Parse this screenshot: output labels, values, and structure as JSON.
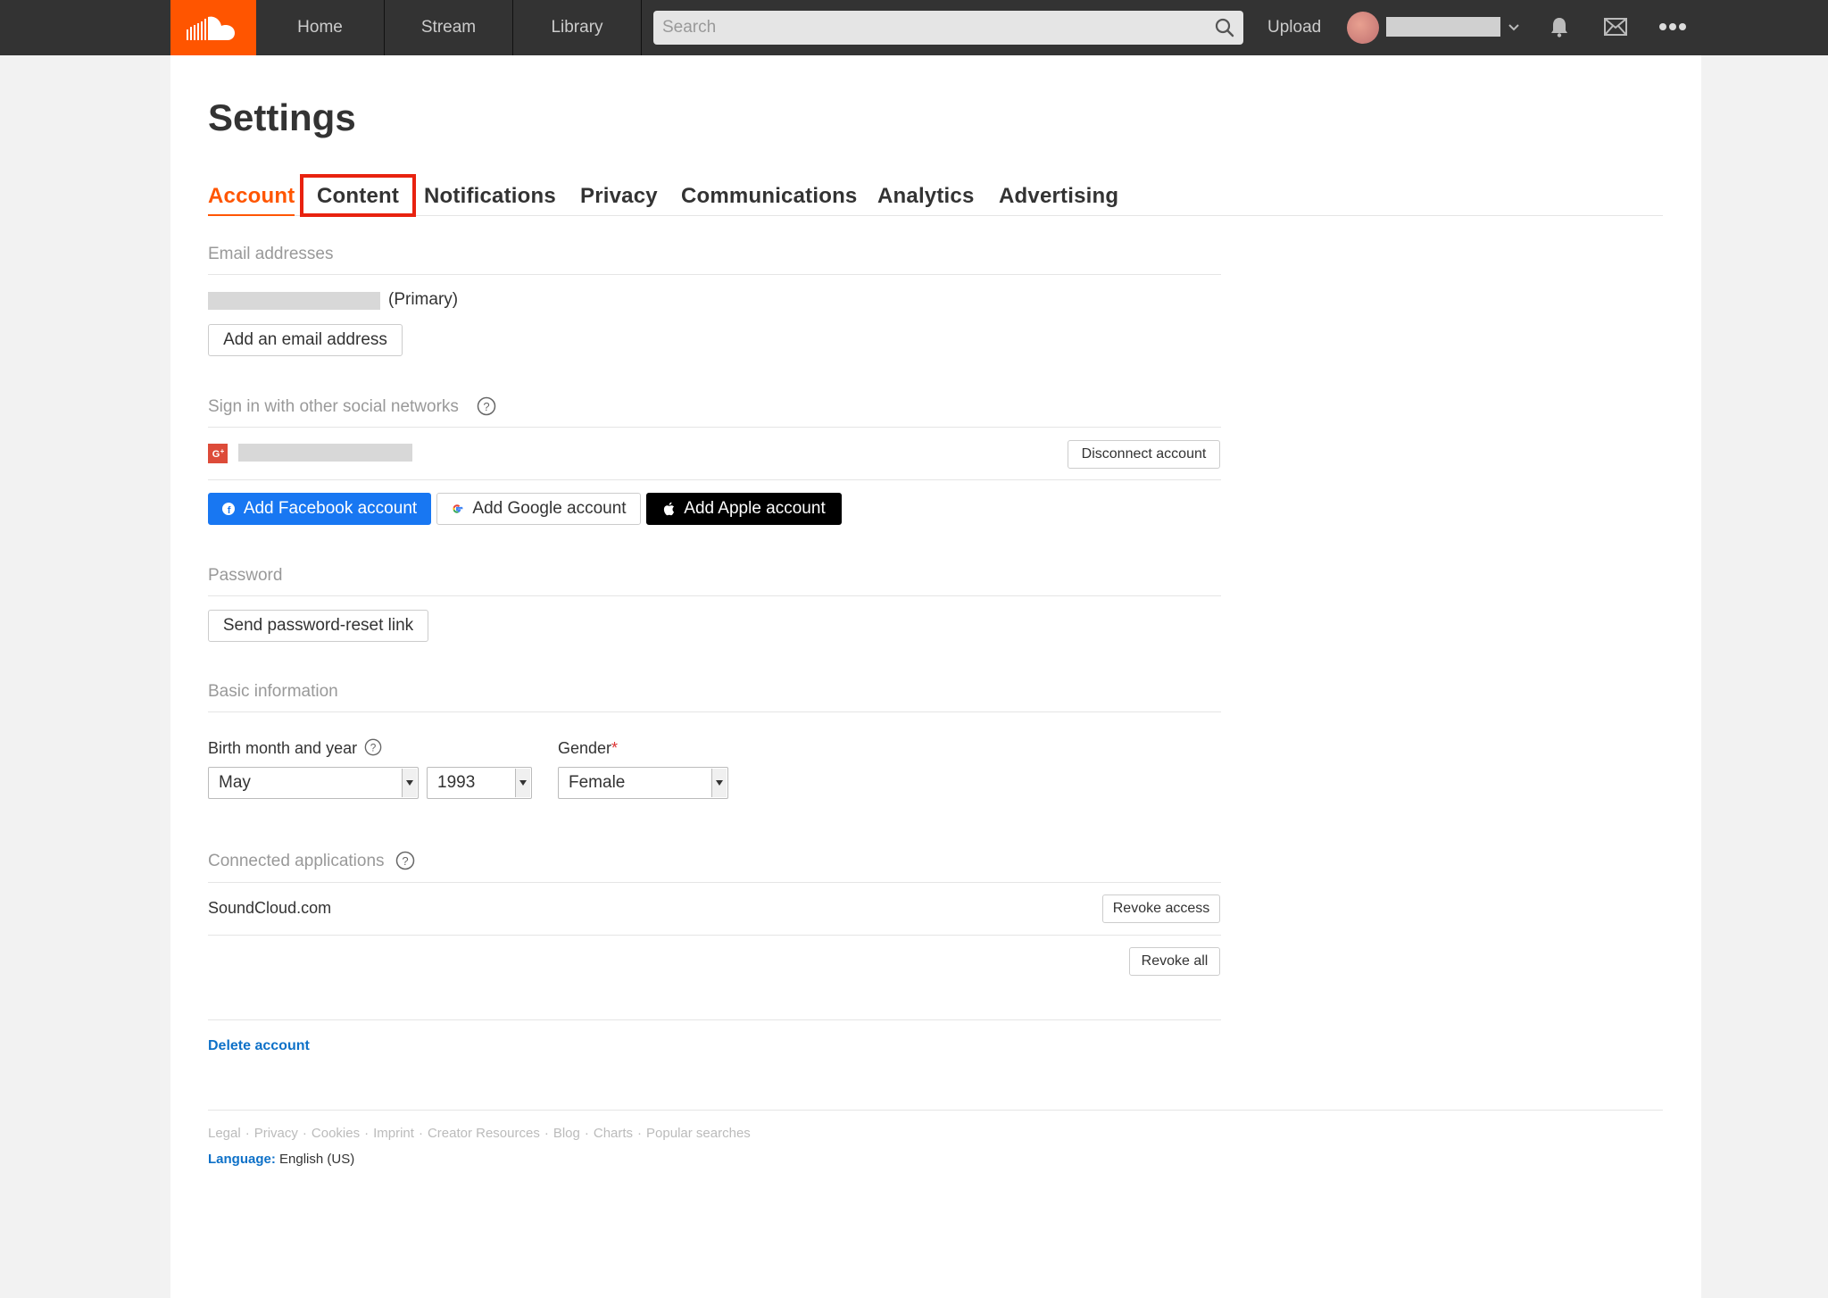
{
  "header": {
    "nav": [
      "Home",
      "Stream",
      "Library"
    ],
    "search_placeholder": "Search",
    "upload": "Upload"
  },
  "page": {
    "title": "Settings",
    "tabs": [
      "Account",
      "Content",
      "Notifications",
      "Privacy",
      "Communications",
      "Analytics",
      "Advertising"
    ],
    "active_tab": "Account",
    "highlighted_tab": "Content"
  },
  "email": {
    "label": "Email addresses",
    "primary_suffix": "(Primary)",
    "add_button": "Add an email address"
  },
  "social": {
    "label": "Sign in with other social networks",
    "disconnect_button": "Disconnect account",
    "facebook_button": "Add Facebook account",
    "google_button": "Add Google account",
    "apple_button": "Add Apple account"
  },
  "password": {
    "label": "Password",
    "reset_button": "Send password-reset link"
  },
  "basic": {
    "label": "Basic information",
    "birth_label": "Birth month and year",
    "birth_month": "May",
    "birth_year": "1993",
    "gender_label": "Gender",
    "gender_required": "*",
    "gender_value": "Female"
  },
  "apps": {
    "label": "Connected applications",
    "items": [
      {
        "name": "SoundCloud.com",
        "action": "Revoke access"
      }
    ],
    "revoke_all": "Revoke all"
  },
  "delete_account": "Delete account",
  "footer": {
    "links": [
      "Legal",
      "Privacy",
      "Cookies",
      "Imprint",
      "Creator Resources",
      "Blog",
      "Charts",
      "Popular searches"
    ],
    "language_label": "Language:",
    "language_value": "English (US)"
  },
  "colors": {
    "accent": "#ff5500",
    "topbar": "#333333",
    "link": "#0e71c8",
    "facebook": "#1877f2",
    "apple": "#000000",
    "google_plus": "#dd4b39",
    "highlight": "#e8220f"
  },
  "icons": [
    "soundcloud-logo-icon",
    "search-icon",
    "chevron-down-icon",
    "bell-icon",
    "mail-icon",
    "more-icon",
    "help-icon",
    "google-plus-icon",
    "facebook-icon",
    "google-icon",
    "apple-icon"
  ]
}
